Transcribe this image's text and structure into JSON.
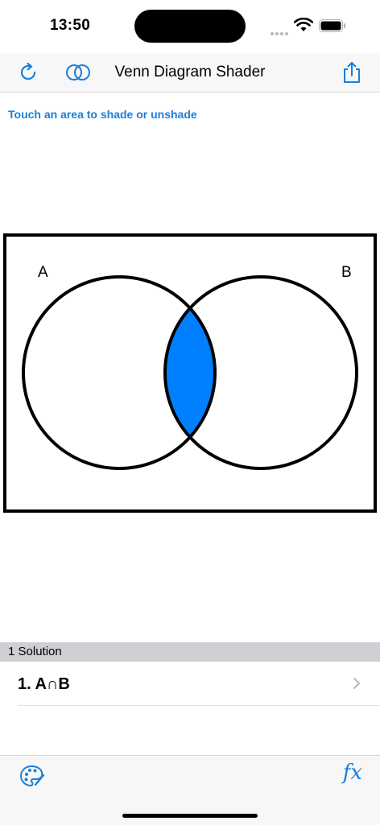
{
  "status": {
    "time": "13:50"
  },
  "nav": {
    "title": "Venn Diagram Shader",
    "left_icons": [
      "refresh-icon",
      "venn-circles-icon"
    ],
    "right_icon": "share-icon"
  },
  "instruction": "Touch an area to shade or unshade",
  "diagram": {
    "set_a_label": "A",
    "set_b_label": "B",
    "shaded_regions": [
      "A∩B"
    ],
    "shade_color": "#0080ff"
  },
  "solutions": {
    "header": "1 Solution",
    "items": [
      {
        "text": "1. A∩B"
      }
    ]
  },
  "toolbar": {
    "left_icon": "palette-icon",
    "right_label": "fx"
  },
  "colors": {
    "accent": "#1a7fd9",
    "shade": "#0080ff"
  }
}
